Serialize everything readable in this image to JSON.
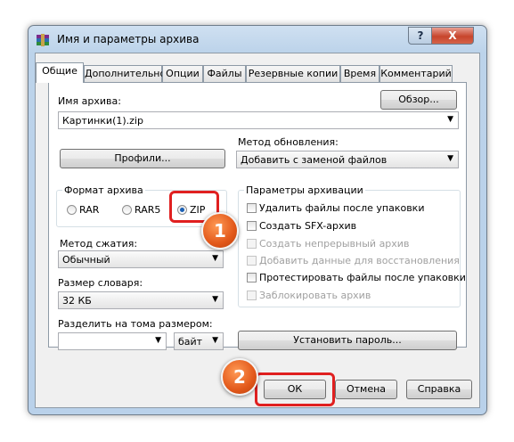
{
  "window": {
    "title": "Имя и параметры архива",
    "help": "?",
    "close": "X"
  },
  "tabs": [
    "Общие",
    "Дополнительно",
    "Опции",
    "Файлы",
    "Резервные копии",
    "Время",
    "Комментарий"
  ],
  "archive_name": {
    "label": "Имя архива:",
    "value": "Картинки(1).zip",
    "browse": "Обзор..."
  },
  "profiles_button": "Профили...",
  "update_method": {
    "label": "Метод обновления:",
    "value": "Добавить с заменой файлов"
  },
  "archive_format": {
    "title": "Формат архива",
    "options": [
      "RAR",
      "RAR5",
      "ZIP"
    ],
    "selected": "ZIP"
  },
  "compression": {
    "label": "Метод сжатия:",
    "value": "Обычный"
  },
  "dictionary": {
    "label": "Размер словаря:",
    "value": "32 КБ"
  },
  "split": {
    "label": "Разделить на тома размером:",
    "value": "",
    "unit": "байт"
  },
  "archive_options": {
    "title": "Параметры архивации",
    "items": [
      {
        "label": "Удалить файлы после упаковки",
        "checked": false,
        "enabled": true
      },
      {
        "label": "Создать SFX-архив",
        "checked": false,
        "enabled": true
      },
      {
        "label": "Создать непрерывный архив",
        "checked": false,
        "enabled": false
      },
      {
        "label": "Добавить данные для восстановления",
        "checked": false,
        "enabled": false
      },
      {
        "label": "Протестировать файлы после упаковки",
        "checked": false,
        "enabled": true
      },
      {
        "label": "Заблокировать архив",
        "checked": false,
        "enabled": false
      }
    ]
  },
  "set_password": "Установить пароль...",
  "footer": {
    "ok": "ОК",
    "cancel": "Отмена",
    "help": "Справка"
  },
  "markers": [
    "1",
    "2"
  ],
  "colors": {
    "highlight": "#e02020",
    "marker": "#e2581a",
    "titlebar": "#bcd3ea"
  }
}
